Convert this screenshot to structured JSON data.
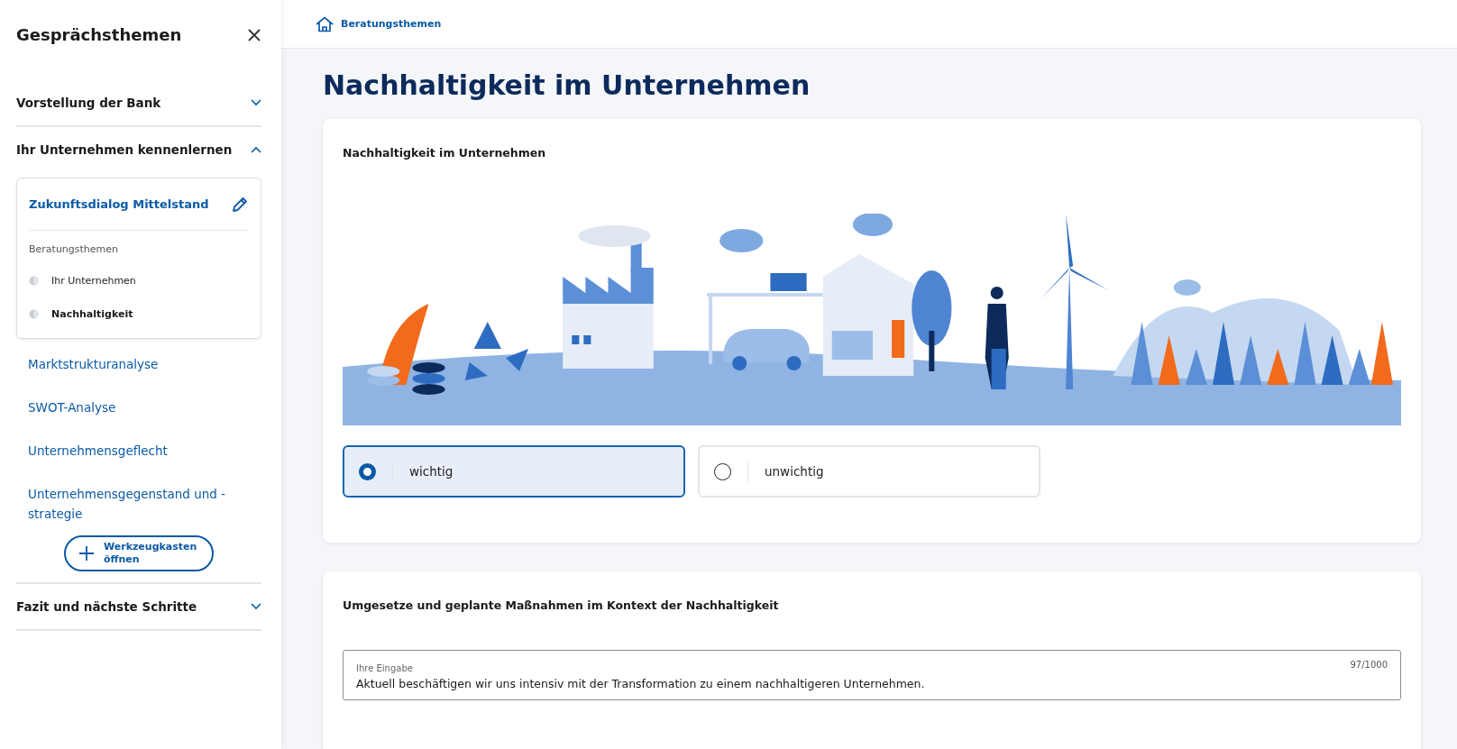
{
  "sidebar": {
    "title": "Gesprächsthemen",
    "sections": [
      {
        "label": "Vorstellung der Bank",
        "expanded": false
      },
      {
        "label": "Ihr Unternehmen kennenlernen",
        "expanded": true,
        "dialog": {
          "title": "Zukunftsdialog Mittelstand",
          "subtitle": "Beratungsthemen",
          "topics": [
            {
              "label": "Ihr Unternehmen",
              "selected": false
            },
            {
              "label": "Nachhaltigkeit",
              "selected": true
            }
          ]
        },
        "links": [
          "Marktstrukturanalyse",
          "SWOT-Analyse",
          "Unternehmensgeflecht",
          "Unternehmensgegenstand und -strategie"
        ],
        "button": "Werkzeugkasten öffnen"
      },
      {
        "label": "Fazit und nächste Schritte",
        "expanded": false
      }
    ]
  },
  "breadcrumb": "Beratungsthemen",
  "page_title": "Nachhaltigkeit im Unternehmen",
  "cards": [
    {
      "kind": "choice",
      "title": "Nachhaltigkeit im Unternehmen",
      "options": [
        {
          "label": "wichtig",
          "selected": true
        },
        {
          "label": "unwichtig",
          "selected": false
        }
      ]
    },
    {
      "kind": "text",
      "title": "Umgesetze und geplante Maßnahmen im Kontext der Nachhaltigkeit",
      "field": {
        "label": "Ihre Eingabe",
        "value": "Aktuell beschäftigen wir uns intensiv mit der Transformation zu einem nachhaltigeren Unternehmen.",
        "counter": "97/1000"
      }
    }
  ]
}
